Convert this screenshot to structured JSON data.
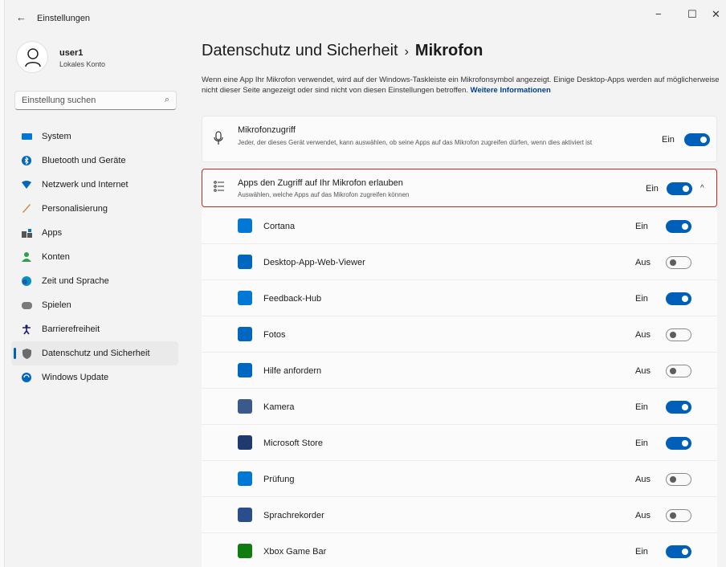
{
  "window": {
    "title": "Einstellungen",
    "back_icon": "←",
    "minimize": "−",
    "maximize": "☐",
    "close": "✕"
  },
  "profile": {
    "name": "user1",
    "account_type": "Lokales Konto"
  },
  "search": {
    "placeholder": "Einstellung suchen",
    "icon": "⌕"
  },
  "nav": {
    "items": [
      {
        "label": "System",
        "icon": "monitor-icon",
        "color": "#0078d4"
      },
      {
        "label": "Bluetooth und Geräte",
        "icon": "bluetooth-icon",
        "color": "#0067c0"
      },
      {
        "label": "Netzwerk und Internet",
        "icon": "wifi-icon",
        "color": "#0067c0"
      },
      {
        "label": "Personalisierung",
        "icon": "brush-icon",
        "color": "#c68b3b"
      },
      {
        "label": "Apps",
        "icon": "apps-icon",
        "color": "#555555"
      },
      {
        "label": "Konten",
        "icon": "person-icon",
        "color": "#2e9e4f"
      },
      {
        "label": "Zeit und Sprache",
        "icon": "globe-clock-icon",
        "color": "#0091c9"
      },
      {
        "label": "Spielen",
        "icon": "gamepad-icon",
        "color": "#7a7a7a"
      },
      {
        "label": "Barrierefreiheit",
        "icon": "accessibility-icon",
        "color": "#1a1a70"
      },
      {
        "label": "Datenschutz und Sicherheit",
        "icon": "shield-icon",
        "color": "#6b6b6b"
      },
      {
        "label": "Windows Update",
        "icon": "update-icon",
        "color": "#0067c0"
      }
    ],
    "active_index": 9
  },
  "page": {
    "breadcrumb_parent": "Datenschutz und Sicherheit",
    "breadcrumb_separator": "›",
    "breadcrumb_current": "Mikrofon",
    "description": "Wenn eine App Ihr Mikrofon verwendet, wird auf der Windows-Taskleiste ein Mikrofonsymbol angezeigt. Einige Desktop-Apps werden auf möglicherweise nicht dieser Seite angezeigt oder sind nicht von diesen Einstellungen betroffen.",
    "more_info_link": "Weitere Informationen"
  },
  "mic_access": {
    "title": "Mikrofonzugriff",
    "subtitle": "Jeder, der dieses Gerät verwendet, kann auswählen, ob seine Apps auf das Mikrofon zugreifen dürfen, wenn dies aktiviert ist",
    "state": "Ein",
    "on": true
  },
  "apps_access": {
    "title": "Apps den Zugriff auf Ihr Mikrofon erlauben",
    "subtitle": "Auswählen, welche Apps auf das Mikrofon zugreifen können",
    "state": "Ein",
    "on": true,
    "chevron": "^"
  },
  "apps": [
    {
      "name": "Cortana",
      "state": "Ein",
      "on": true,
      "icon_color": "#0078d4"
    },
    {
      "name": "Desktop-App-Web-Viewer",
      "state": "Aus",
      "on": false,
      "icon_color": "#0067c0"
    },
    {
      "name": "Feedback-Hub",
      "state": "Ein",
      "on": true,
      "icon_color": "#0078d4"
    },
    {
      "name": "Fotos",
      "state": "Aus",
      "on": false,
      "icon_color": "#0067c0"
    },
    {
      "name": "Hilfe anfordern",
      "state": "Aus",
      "on": false,
      "icon_color": "#0067c0"
    },
    {
      "name": "Kamera",
      "state": "Ein",
      "on": true,
      "icon_color": "#3a5a8c"
    },
    {
      "name": "Microsoft Store",
      "state": "Ein",
      "on": true,
      "icon_color": "#1f3b6e"
    },
    {
      "name": "Prüfung",
      "state": "Aus",
      "on": false,
      "icon_color": "#0078d4"
    },
    {
      "name": "Sprachrekorder",
      "state": "Aus",
      "on": false,
      "icon_color": "#2a4e8c"
    },
    {
      "name": "Xbox Game Bar",
      "state": "Ein",
      "on": true,
      "icon_color": "#107c10"
    }
  ],
  "colors": {
    "accent": "#005fb8",
    "highlight_border": "#c42b1c"
  }
}
